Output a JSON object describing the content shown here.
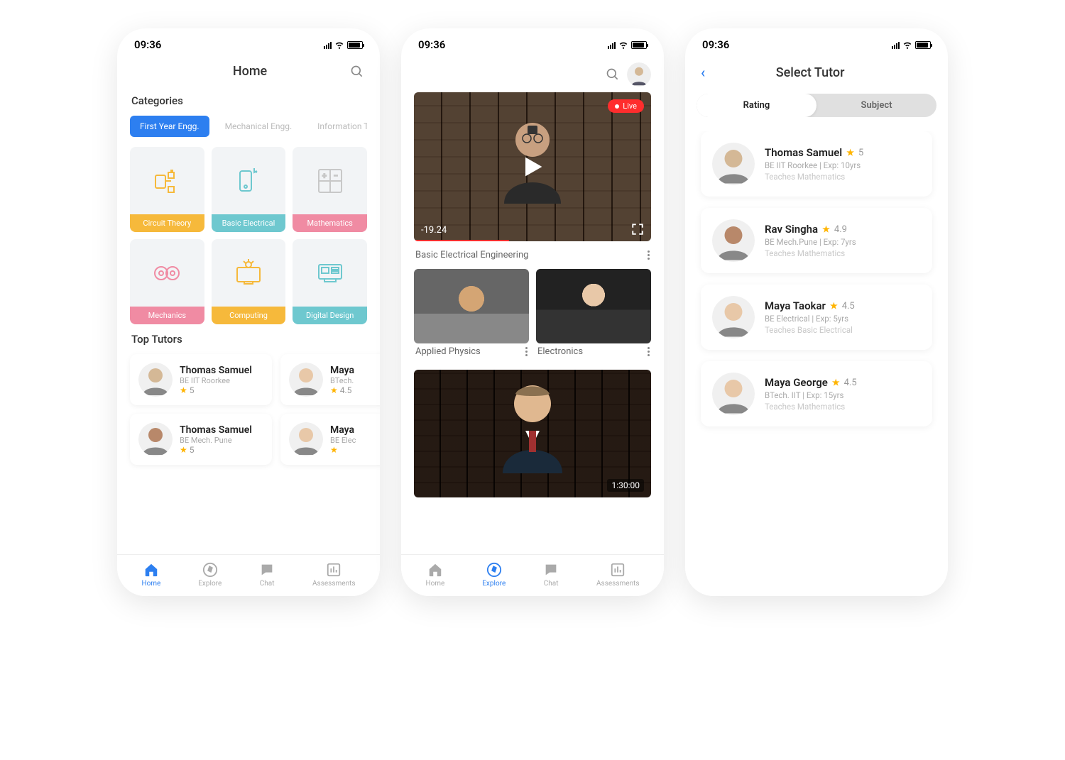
{
  "status_bar": {
    "time": "09:36"
  },
  "screen1": {
    "title": "Home",
    "categories_label": "Categories",
    "chips": [
      {
        "label": "First Year Engg.",
        "active": true
      },
      {
        "label": "Mechanical Engg.",
        "active": false
      },
      {
        "label": "Information T",
        "active": false
      }
    ],
    "cats": [
      {
        "label": "Circuit Theory",
        "color": "#f6b93b",
        "icon_color": "#f6b93b"
      },
      {
        "label": "Basic Electrical",
        "color": "#6ec8cf",
        "icon_color": "#6ec8cf"
      },
      {
        "label": "Mathematics",
        "color": "#f08ba3",
        "icon_color": "#c8c8c8"
      },
      {
        "label": "Mechanics",
        "color": "#f08ba3",
        "icon_color": "#f08ba3"
      },
      {
        "label": "Computing",
        "color": "#f6b93b",
        "icon_color": "#f6b93b"
      },
      {
        "label": "Digital Design",
        "color": "#6ec8cf",
        "icon_color": "#6ec8cf"
      }
    ],
    "top_tutors_label": "Top Tutors",
    "tutors": [
      {
        "name": "Thomas Samuel",
        "sub": "BE IIT Roorkee",
        "rating": "5",
        "avatar_color": "#d4b896"
      },
      {
        "name": "Maya",
        "sub": "BTech.",
        "rating": "4.5",
        "avatar_color": "#e8c8a8"
      },
      {
        "name": "Thomas Samuel",
        "sub": "BE Mech. Pune",
        "rating": "5",
        "avatar_color": "#b8886a"
      },
      {
        "name": "Maya",
        "sub": "BE Elec",
        "rating": "",
        "avatar_color": "#e8c8a8"
      }
    ]
  },
  "screen2": {
    "main_video": {
      "title": "Basic Electrical Engineering",
      "timer": "-19.24",
      "live_label": "Live"
    },
    "side_videos": [
      {
        "title": "Applied Physics"
      },
      {
        "title": "Electronics"
      }
    ],
    "bottom_video": {
      "duration": "1:30:00"
    }
  },
  "screen3": {
    "title": "Select Tutor",
    "tabs": [
      {
        "label": "Rating",
        "active": true
      },
      {
        "label": "Subject",
        "active": false
      }
    ],
    "tutors": [
      {
        "name": "Thomas Samuel",
        "rating": "5",
        "sub": "BE IIT Roorkee | Exp: 10yrs",
        "teaches": "Teaches Mathematics",
        "avatar_color": "#d4b896"
      },
      {
        "name": "Rav Singha",
        "rating": "4.9",
        "sub": "BE Mech.Pune | Exp: 7yrs",
        "teaches": "Teaches Mathematics",
        "avatar_color": "#b8886a"
      },
      {
        "name": "Maya Taokar",
        "rating": "4.5",
        "sub": "BE Electrical | Exp: 5yrs",
        "teaches": "Teaches Basic Electrical",
        "avatar_color": "#e8c8a8"
      },
      {
        "name": "Maya George",
        "rating": "4.5",
        "sub": "BTech. IIT | Exp: 15yrs",
        "teaches": "Teaches Mathematics",
        "avatar_color": "#e8c8a8"
      }
    ]
  },
  "nav": [
    {
      "label": "Home",
      "icon": "home"
    },
    {
      "label": "Explore",
      "icon": "compass"
    },
    {
      "label": "Chat",
      "icon": "chat"
    },
    {
      "label": "Assessments",
      "icon": "bars"
    }
  ],
  "nav_active": {
    "screen1": 0,
    "screen2": 1
  }
}
